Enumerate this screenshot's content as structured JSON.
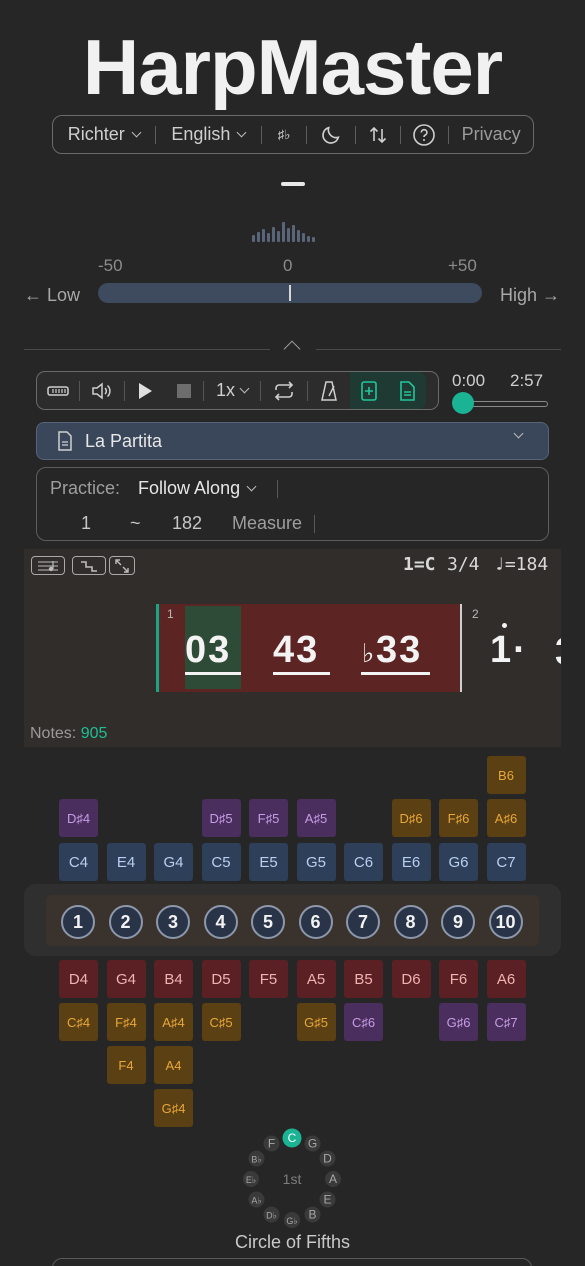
{
  "app": {
    "title": "HarpMaster"
  },
  "topbar": {
    "tuning": "Richter",
    "language": "English",
    "accidental_icon": "♯♭",
    "privacy": "Privacy"
  },
  "tuner": {
    "minus": "-50",
    "zero": "0",
    "plus": "+50",
    "low": "← Low",
    "high": "High →",
    "deviation_cents": 0
  },
  "player": {
    "speed": "1x",
    "time_current": "0:00",
    "time_total": "2:57",
    "progress": 0
  },
  "song": {
    "name": "La Partita"
  },
  "practice": {
    "label": "Practice:",
    "mode": "Follow Along",
    "from": "1",
    "tilde": "~",
    "to": "182",
    "unit": "Measure"
  },
  "score": {
    "key": "1=C",
    "time_sig": "3/4",
    "tempo": "♩=184",
    "measure1": "1",
    "measure2": "2",
    "notes": [
      "03",
      "43",
      "33"
    ],
    "flat": "♭",
    "next_note": "1·",
    "notes_label": "Notes: ",
    "notes_count": "905"
  },
  "blow_bends_top": [
    {
      "label": "B6",
      "col": 9,
      "row": 0,
      "color": "orange"
    }
  ],
  "blow_bends": [
    {
      "label": "D♯4",
      "col": 0,
      "color": "purple"
    },
    {
      "label": "D♯5",
      "col": 3,
      "color": "purple"
    },
    {
      "label": "F♯5",
      "col": 4,
      "color": "purple"
    },
    {
      "label": "A♯5",
      "col": 5,
      "color": "purple"
    },
    {
      "label": "D♯6",
      "col": 7,
      "color": "orange"
    },
    {
      "label": "F♯6",
      "col": 8,
      "color": "orange"
    },
    {
      "label": "A♯6",
      "col": 9,
      "color": "orange"
    }
  ],
  "blow_notes": [
    "C4",
    "E4",
    "G4",
    "C5",
    "E5",
    "G5",
    "C6",
    "E6",
    "G6",
    "C7"
  ],
  "holes": [
    "1",
    "2",
    "3",
    "4",
    "5",
    "6",
    "7",
    "8",
    "9",
    "10"
  ],
  "draw_notes": [
    "D4",
    "G4",
    "B4",
    "D5",
    "F5",
    "A5",
    "B5",
    "D6",
    "F6",
    "A6"
  ],
  "draw_bends_1": [
    {
      "label": "C♯4",
      "col": 0,
      "color": "orange"
    },
    {
      "label": "F♯4",
      "col": 1,
      "color": "orange"
    },
    {
      "label": "A♯4",
      "col": 2,
      "color": "orange"
    },
    {
      "label": "C♯5",
      "col": 3,
      "color": "orange"
    },
    {
      "label": "G♯5",
      "col": 5,
      "color": "orange"
    },
    {
      "label": "C♯6",
      "col": 6,
      "color": "purple"
    },
    {
      "label": "G♯6",
      "col": 8,
      "color": "purple"
    },
    {
      "label": "C♯7",
      "col": 9,
      "color": "purple"
    }
  ],
  "draw_bends_2": [
    {
      "label": "F4",
      "col": 1,
      "color": "orange"
    },
    {
      "label": "A4",
      "col": 2,
      "color": "orange"
    }
  ],
  "draw_bends_3": [
    {
      "label": "G♯4",
      "col": 2,
      "color": "orange"
    }
  ],
  "circle_of_fifths": {
    "center": "1st",
    "keys": [
      "C",
      "G",
      "D",
      "A",
      "E",
      "B",
      "G♭",
      "D♭",
      "A♭",
      "E♭",
      "B♭",
      "F"
    ],
    "selected": "C",
    "label": "Circle of Fifths"
  },
  "colors": {
    "accent": "#1ab394",
    "blue_key": "#2e3f5a",
    "purple_key": "#4a2e5e",
    "orange_key": "#5a4012",
    "red_key": "#5a2024"
  }
}
